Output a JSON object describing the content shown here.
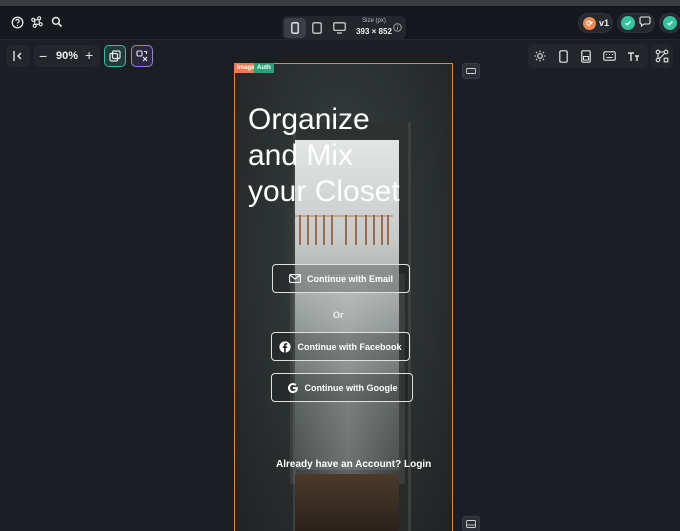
{
  "topbar": {
    "icons": [
      "help-icon",
      "command-icon",
      "search-icon"
    ],
    "device_size": {
      "label": "Size (px)",
      "value": "393 × 852"
    },
    "version_label": "v1",
    "colors": {
      "accent_teal": "#2dbf9f",
      "accent_orange": "#f08a55",
      "frame_border": "#d58c4a"
    }
  },
  "toolbar": {
    "zoom_label": "90%",
    "minus_label": "−",
    "plus_label": "+"
  },
  "frame": {
    "tag_image": "Image",
    "tag_auth": "Auth"
  },
  "screen": {
    "title": "Organize\nand Mix\nyour Closet",
    "email_button": "Continue with Email",
    "or_label": "Or",
    "facebook_button": "Continue with Facebook",
    "google_button": "Continue with Google",
    "login_prompt": "Already have an Account? Login"
  }
}
